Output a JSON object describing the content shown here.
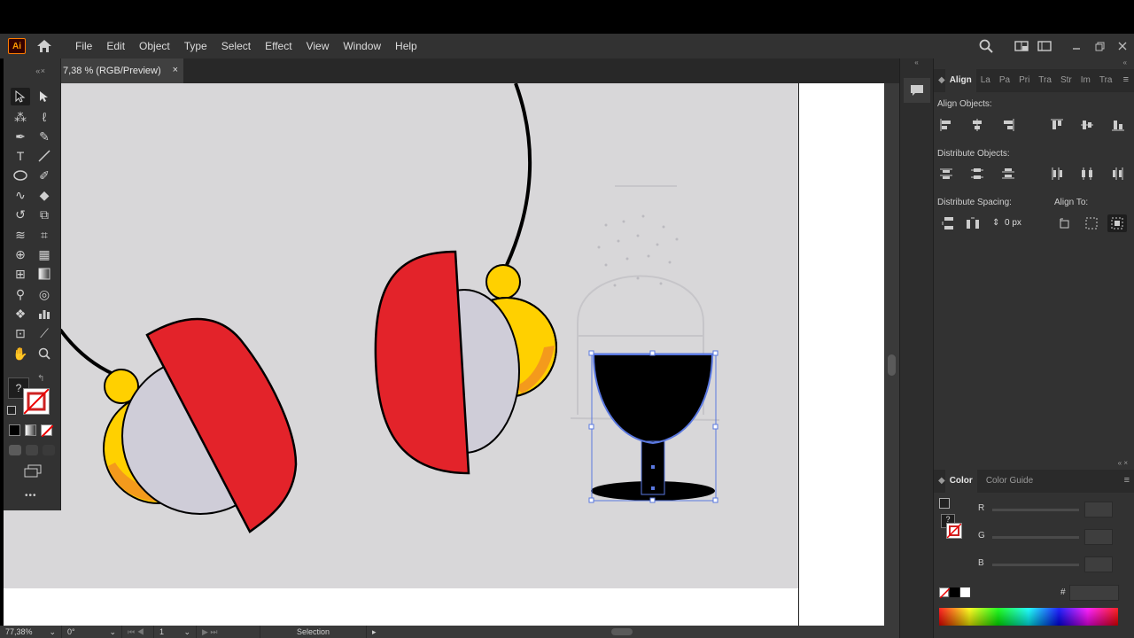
{
  "app": {
    "logo_text": "Ai"
  },
  "menu": {
    "items": [
      "File",
      "Edit",
      "Object",
      "Type",
      "Select",
      "Effect",
      "View",
      "Window",
      "Help"
    ]
  },
  "document_tab": {
    "label": "7,38 % (RGB/Preview)",
    "close_glyph": "×"
  },
  "toolbar": {
    "header_glyph": "«  ×",
    "more_glyph": "•••",
    "question_glyph": "?"
  },
  "panels": {
    "top_tabs": [
      "Align",
      "La",
      "Pa",
      "Pri",
      "Tra",
      "Str",
      "Im",
      "Tra"
    ],
    "align_objects_label": "Align Objects:",
    "distribute_objects_label": "Distribute Objects:",
    "distribute_spacing_label": "Distribute Spacing:",
    "align_to_label": "Align To:",
    "spacing_value": "0 px",
    "color_tabs": [
      "Color",
      "Color Guide"
    ],
    "channels": [
      "R",
      "G",
      "B"
    ],
    "hex_label": "#"
  },
  "status": {
    "zoom": "77,38%",
    "rotation": "0°",
    "artboard_number": "1",
    "tool_name": "Selection"
  },
  "colors": {
    "red": "#e3232a",
    "yellow": "#ffd000",
    "orange": "#f49a1c",
    "lavender": "#cfcdd8",
    "selection": "#5a78e0"
  }
}
